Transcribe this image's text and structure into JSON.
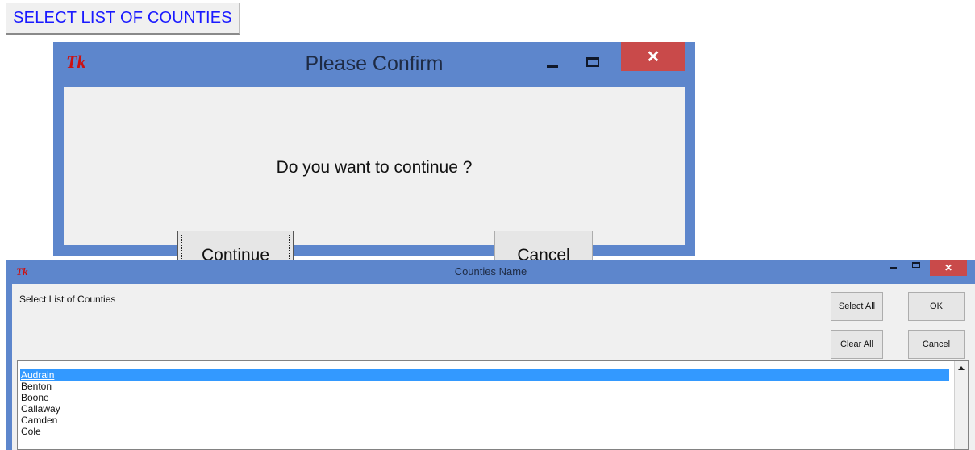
{
  "launcher": {
    "label": "SELECT LIST OF COUNTIES"
  },
  "dialog": {
    "app_icon": "Tk",
    "title": "Please Confirm",
    "close_glyph": "✕",
    "message": "Do you want to continue ?",
    "continue_label": "Continue",
    "cancel_label": "Cancel"
  },
  "counties_window": {
    "app_icon": "Tk",
    "title": "Counties Name",
    "close_glyph": "✕",
    "label": "Select List of Counties",
    "select_all_label": "Select All",
    "ok_label": "OK",
    "clear_all_label": "Clear All",
    "cancel_label": "Cancel",
    "items": [
      "Audrain",
      "Benton",
      "Boone",
      "Callaway",
      "Camden",
      "Cole"
    ],
    "selected_index": 0
  },
  "colors": {
    "titlebar": "#5d86cc",
    "close": "#c94a4a",
    "selection": "#3399ff",
    "launcher_text": "#1a1aff"
  }
}
